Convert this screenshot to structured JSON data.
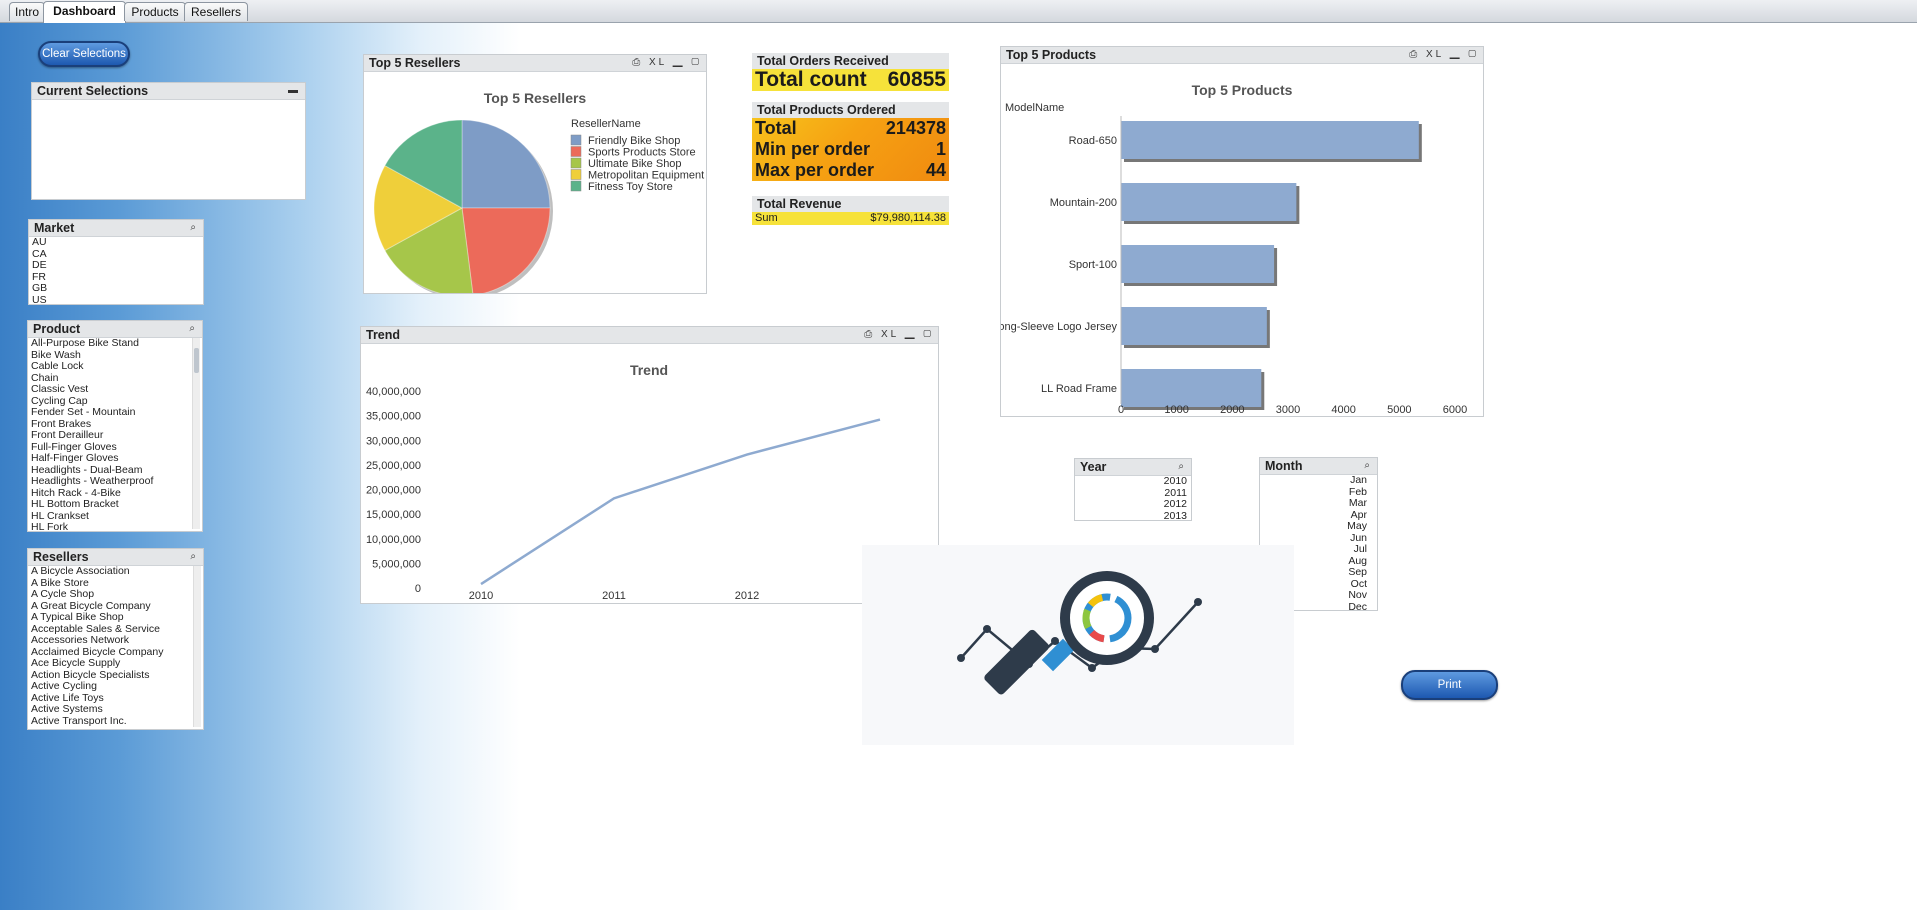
{
  "tabs": [
    "Intro",
    "Dashboard",
    "Products",
    "Resellers"
  ],
  "clear_button": "Clear Selections",
  "print_button": "Print",
  "current_selections": {
    "title": "Current Selections"
  },
  "market": {
    "title": "Market",
    "items": [
      "AU",
      "CA",
      "DE",
      "FR",
      "GB",
      "US"
    ]
  },
  "product": {
    "title": "Product",
    "items": [
      "All-Purpose Bike Stand",
      "Bike Wash",
      "Cable Lock",
      "Chain",
      "Classic Vest",
      "Cycling Cap",
      "Fender Set - Mountain",
      "Front Brakes",
      "Front Derailleur",
      "Full-Finger Gloves",
      "Half-Finger Gloves",
      "Headlights - Dual-Beam",
      "Headlights - Weatherproof",
      "Hitch Rack - 4-Bike",
      "HL Bottom Bracket",
      "HL Crankset",
      "HL Fork"
    ]
  },
  "resellers": {
    "title": "Resellers",
    "items": [
      "A Bicycle Association",
      "A Bike Store",
      "A Cycle Shop",
      "A Great Bicycle Company",
      "A Typical Bike Shop",
      "Acceptable Sales & Service",
      "Accessories Network",
      "Acclaimed Bicycle Company",
      "Ace Bicycle Supply",
      "Action Bicycle Specialists",
      "Active Cycling",
      "Active Life Toys",
      "Active Systems",
      "Active Transport Inc."
    ]
  },
  "year": {
    "title": "Year",
    "items": [
      "2010",
      "2011",
      "2012",
      "2013"
    ]
  },
  "month": {
    "title": "Month",
    "items": [
      "Jan",
      "Feb",
      "Mar",
      "Apr",
      "May",
      "Jun",
      "Jul",
      "Aug",
      "Sep",
      "Oct",
      "Nov",
      "Dec"
    ]
  },
  "orders": {
    "title": "Total Orders Received",
    "label": "Total count",
    "value": "60855"
  },
  "products_ordered": {
    "title": "Total Products Ordered",
    "rows": [
      {
        "label": "Total",
        "value": "214378"
      },
      {
        "label": "Min per order",
        "value": "1"
      },
      {
        "label": "Max per order",
        "value": "44"
      }
    ]
  },
  "revenue": {
    "title": "Total Revenue",
    "label": "Sum",
    "value": "$79,980,114.38"
  },
  "top_resellers_caption": "Top 5 Resellers",
  "top_products_caption": "Top 5 Products",
  "trend_caption": "Trend",
  "caption_icons": "⎙ XL ▁ ▢",
  "colors": {
    "accent": "#2a63b8",
    "kpi_yellow": "#f6e23a",
    "kpi_orange": "#f49a12",
    "bar": "#8eaad0"
  },
  "chart_data": [
    {
      "type": "pie",
      "title": "Top 5 Resellers",
      "legend_title": "ResellerName",
      "legend_position": "right",
      "categories": [
        "Friendly Bike Shop",
        "Sports Products Store",
        "Ultimate Bike Shop",
        "Metropolitan Equipment",
        "Fitness Toy Store"
      ],
      "values": [
        25,
        23,
        19,
        16,
        17
      ],
      "colors": [
        "#7e9cc6",
        "#ec6a5a",
        "#a6c64a",
        "#efcf3a",
        "#5bb38a"
      ]
    },
    {
      "type": "bar",
      "orientation": "horizontal",
      "title": "Top 5 Products",
      "ylabel": "ModelName",
      "categories": [
        "Road-650",
        "Mountain-200",
        "Sport-100",
        "Long-Sleeve Logo Jersey",
        "LL Road Frame"
      ],
      "values": [
        5350,
        3150,
        2750,
        2620,
        2520
      ],
      "xlim": [
        0,
        6000
      ],
      "xticks": [
        0,
        1000,
        2000,
        3000,
        4000,
        5000,
        6000
      ]
    },
    {
      "type": "line",
      "title": "Trend",
      "xlabel": "Year",
      "x": [
        "2010",
        "2011",
        "2012",
        "2013"
      ],
      "values": [
        800000,
        18200000,
        27100000,
        34200000
      ],
      "ylim": [
        0,
        40000000
      ],
      "yticks": [
        "0",
        "5,000,000",
        "10,000,000",
        "15,000,000",
        "20,000,000",
        "25,000,000",
        "30,000,000",
        "35,000,000",
        "40,000,000"
      ]
    }
  ]
}
